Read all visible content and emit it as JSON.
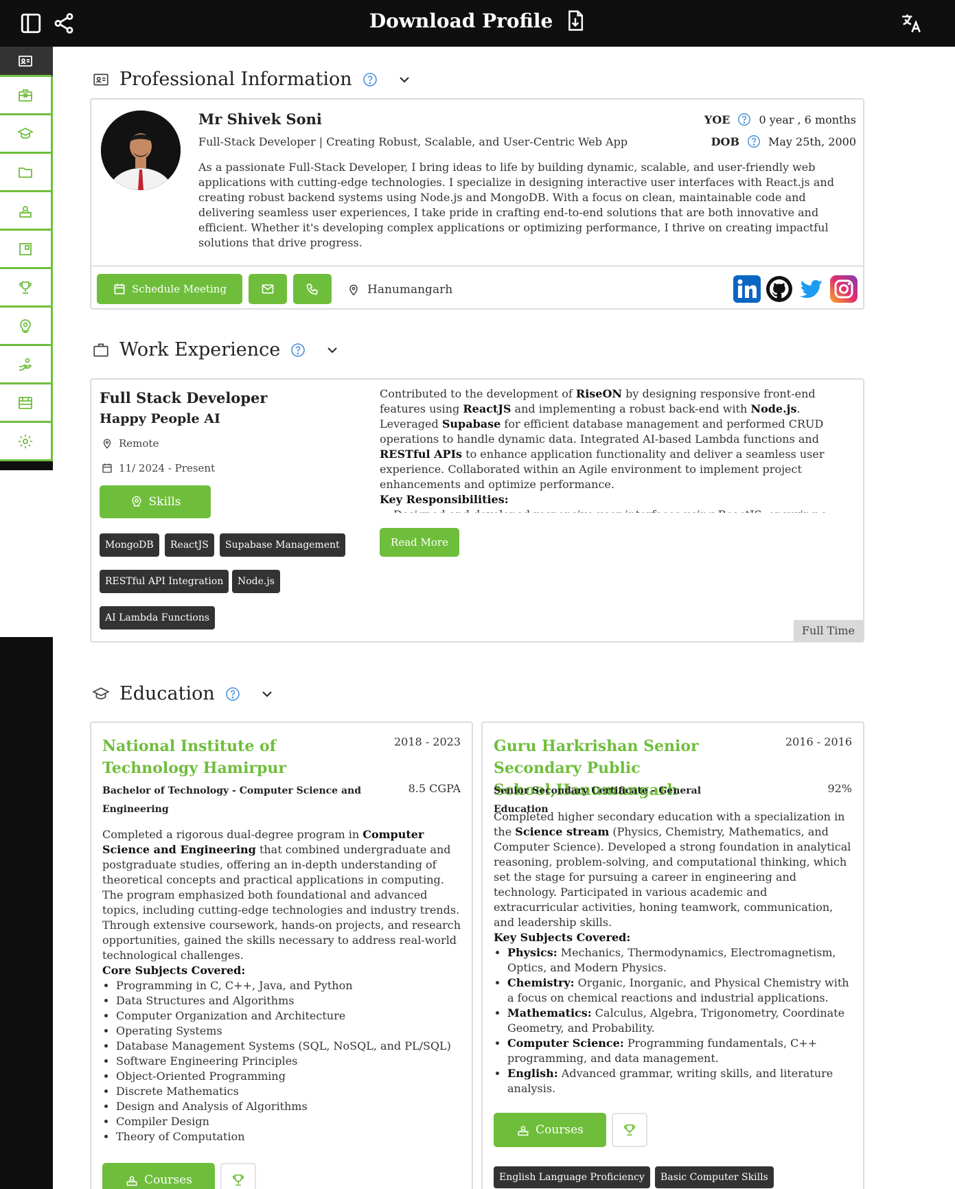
{
  "topbar": {
    "title": "Download Profile",
    "icons": [
      "sidebar-toggle-icon",
      "share-icon",
      "download-file-icon",
      "translate-icon"
    ]
  },
  "sidenav": {
    "items": [
      "id-card-icon",
      "briefcase-icon",
      "graduation-cap-icon",
      "folder-icon",
      "certificate-icon",
      "publication-icon",
      "trophy-icon",
      "skills-icon",
      "volunteer-icon",
      "store-icon",
      "settings-icon"
    ]
  },
  "colors": {
    "accent": "#6fbe3b",
    "topbar": "#0f0f0f",
    "tag": "#333333"
  },
  "professional": {
    "section_title": "Professional Information",
    "name": "Mr Shivek Soni",
    "headline": "Full-Stack Developer | Creating Robust, Scalable, and User-Centric Web App",
    "bio": "As a passionate Full-Stack Developer, I bring ideas to life by building dynamic, scalable, and user-friendly web applications with cutting-edge technologies. I specialize in designing interactive user interfaces with React.js and creating robust backend systems using Node.js and MongoDB. With a focus on clean, maintainable code and delivering seamless user experiences, I take pride in crafting end-to-end solutions that are both innovative and efficient. Whether it's developing complex applications or optimizing performance, I thrive on creating impactful solutions that drive progress.",
    "yoe_label": "YOE",
    "yoe_value": "0 year , 6 months",
    "dob_label": "DOB",
    "dob_value": "May 25th, 2000",
    "schedule_label": "Schedule Meeting",
    "location": "Hanumangarh",
    "socials": [
      "linkedin-icon",
      "github-icon",
      "twitter-icon",
      "instagram-icon"
    ]
  },
  "work": {
    "section_title": "Work Experience",
    "title": "Full Stack Developer",
    "company": "Happy People AI",
    "location": "Remote",
    "dates": "11/ 2024 - Present",
    "skills_label": "Skills",
    "tags": [
      "MongoDB",
      "ReactJS",
      "Supabase Management",
      "RESTful API Integration",
      "Node.js",
      "AI Lambda Functions"
    ],
    "desc": {
      "p1": "Contributed to the development of ",
      "b1": "RiseON",
      "p2": " by designing responsive front-end features using ",
      "b2": "ReactJS",
      "p3": " and implementing a robust back-end with ",
      "b3": "Node.js",
      "p4": ". Leveraged ",
      "b4": "Supabase",
      "p5": " for efficient database management and performed CRUD operations to handle dynamic data. Integrated AI-based Lambda functions and ",
      "b5": "RESTful APIs",
      "p6": " to enhance application functionality and deliver a seamless user experience. Collaborated within an Agile environment to implement project enhancements and optimize performance.",
      "key_label": "Key Responsibilities:",
      "first_item": "Designed and developed responsive user interfaces using ReactJS, ensuring a"
    },
    "read_more": "Read More",
    "employment_type": "Full Time"
  },
  "education": {
    "section_title": "Education",
    "items": [
      {
        "school": "National Institute of Technology Hamirpur",
        "years": "2018 - 2023",
        "degree": "Bachelor of Technology - Computer Science and Engineering",
        "grade": "8.5 CGPA",
        "p1": "Completed a rigorous dual-degree program in ",
        "b1": "Computer Science and Engineering",
        "p2": " that combined undergraduate and postgraduate studies, offering an in-depth understanding of theoretical concepts and practical applications in computing. The program emphasized both foundational and advanced topics, including cutting-edge technologies and industry trends. Through extensive coursework, hands-on projects, and research opportunities, gained the skills necessary to address real-world technological challenges.",
        "list_title": "Core Subjects Covered:",
        "subjects": [
          "Programming in C, C++, Java, and Python",
          "Data Structures and Algorithms",
          "Computer Organization and Architecture",
          "Operating Systems",
          "Database Management Systems (SQL, NoSQL, and PL/SQL)",
          "Software Engineering Principles",
          "Object-Oriented Programming",
          "Discrete Mathematics",
          "Design and Analysis of Algorithms",
          "Compiler Design",
          "Theory of Computation"
        ],
        "courses_label": "Courses"
      },
      {
        "school": "Guru Harkrishan Senior Secondary Public School,Hanumangarh",
        "years": "2016 - 2016",
        "degree": "Senior Secondary Certificate - General Education",
        "grade": "92%",
        "p1": "Completed higher secondary education with a specialization in the ",
        "b1": "Science stream",
        "p2": " (Physics, Chemistry, Mathematics, and Computer Science). Developed a strong foundation in analytical reasoning, problem-solving, and computational thinking, which set the stage for pursuing a career in engineering and technology. Participated in various academic and extracurricular activities, honing teamwork, communication, and leadership skills.",
        "list_title": "Key Subjects Covered:",
        "subjects": [
          {
            "k": "Physics:",
            "v": " Mechanics, Thermodynamics, Electromagnetism, Optics, and Modern Physics."
          },
          {
            "k": "Chemistry:",
            "v": " Organic, Inorganic, and Physical Chemistry with a focus on chemical reactions and industrial applications."
          },
          {
            "k": "Mathematics:",
            "v": " Calculus, Algebra, Trigonometry, Coordinate Geometry, and Probability."
          },
          {
            "k": "Computer Science:",
            "v": " Programming fundamentals, C++ programming, and data management."
          },
          {
            "k": "English:",
            "v": " Advanced grammar, writing skills, and literature analysis."
          }
        ],
        "courses_label": "Courses",
        "tags": [
          "English Language Proficiency",
          "Basic Computer Skills"
        ]
      }
    ]
  }
}
